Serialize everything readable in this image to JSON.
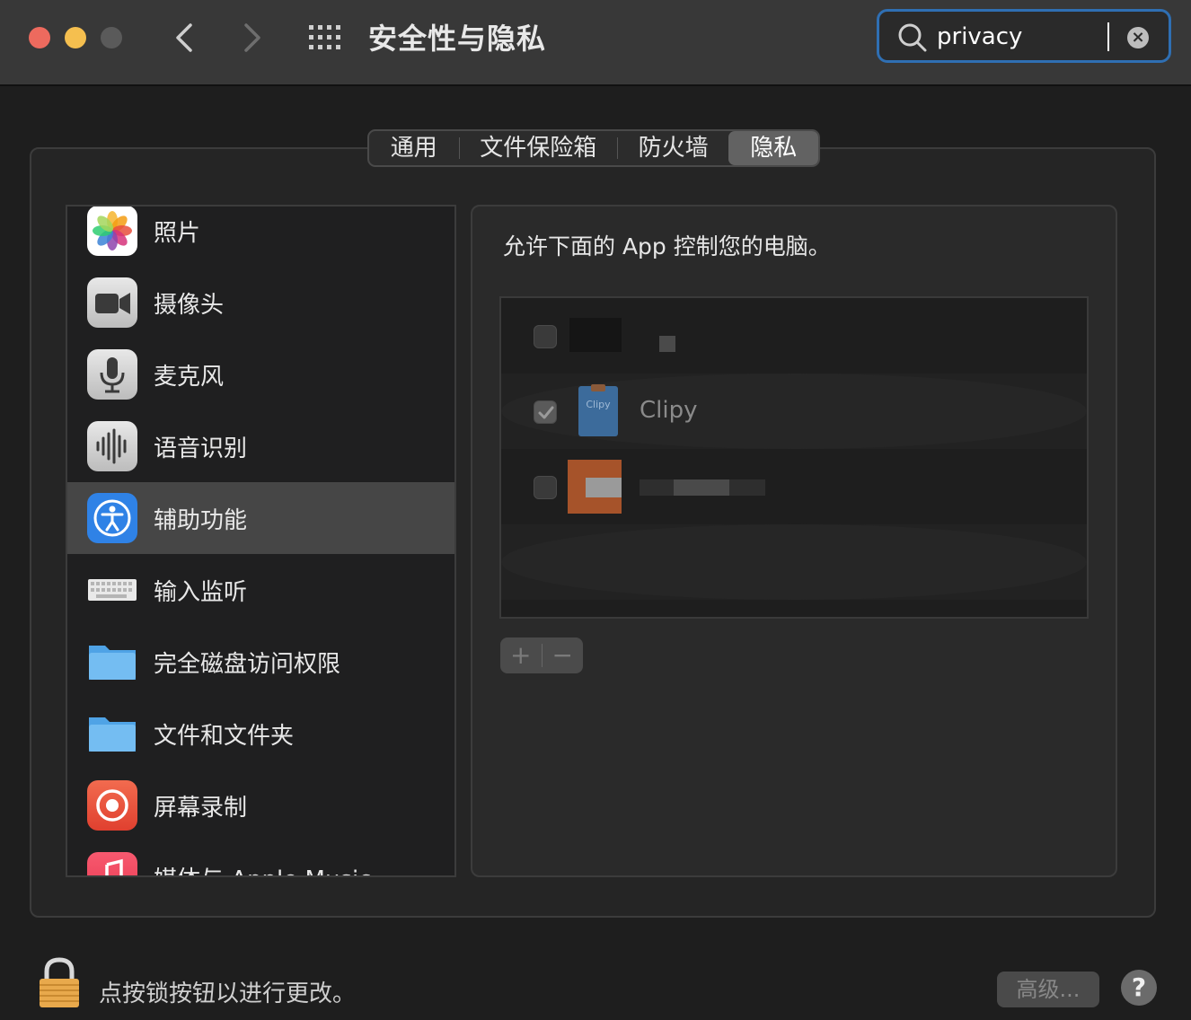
{
  "window": {
    "title": "安全性与隐私",
    "search_value": "privacy"
  },
  "tabs": [
    {
      "label": "通用"
    },
    {
      "label": "文件保险箱"
    },
    {
      "label": "防火墙"
    },
    {
      "label": "隐私",
      "selected": true
    }
  ],
  "sidebar": {
    "items": [
      {
        "label": "照片",
        "icon": "photos-icon"
      },
      {
        "label": "摄像头",
        "icon": "camera-icon"
      },
      {
        "label": "麦克风",
        "icon": "microphone-icon"
      },
      {
        "label": "语音识别",
        "icon": "speech-recognition-icon"
      },
      {
        "label": "辅助功能",
        "icon": "accessibility-icon",
        "selected": true
      },
      {
        "label": "输入监听",
        "icon": "keyboard-icon"
      },
      {
        "label": "完全磁盘访问权限",
        "icon": "folder-icon"
      },
      {
        "label": "文件和文件夹",
        "icon": "folder-icon"
      },
      {
        "label": "屏幕录制",
        "icon": "screen-recording-icon"
      },
      {
        "label": "媒体与 Apple Music",
        "icon": "music-icon"
      }
    ]
  },
  "detail": {
    "title": "允许下面的 App 控制您的电脑。",
    "apps": [
      {
        "name": "",
        "checked": false
      },
      {
        "name": "Clipy",
        "checked": true,
        "icon_label": "Clipy"
      },
      {
        "name": "",
        "checked": false
      }
    ],
    "add_label": "+",
    "remove_label": "−"
  },
  "footer": {
    "lock_text": "点按锁按钮以进行更改。",
    "advanced_label": "高级...",
    "help_label": "?"
  },
  "colors": {
    "accent": "#2f6fb3",
    "selected_row": "#464646",
    "traffic_red": "#ed6a5e",
    "traffic_yellow": "#f5bf4f"
  }
}
